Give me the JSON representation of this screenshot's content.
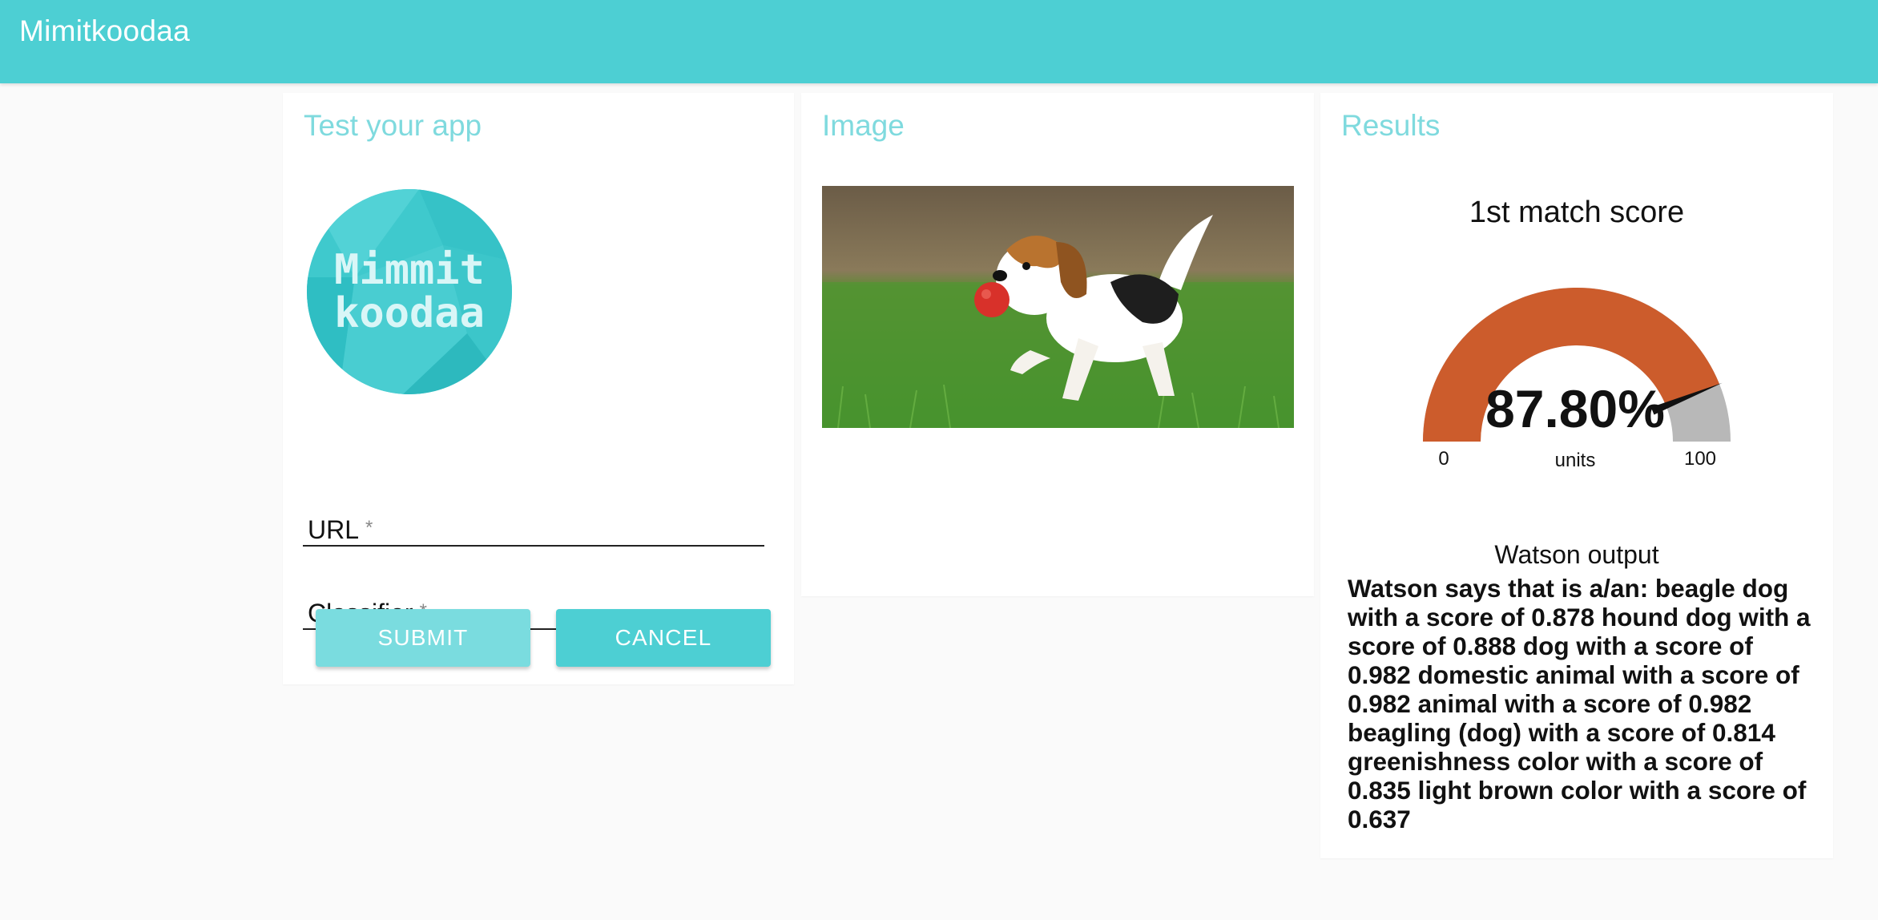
{
  "app": {
    "title": "Mimitkoodaa"
  },
  "test_panel": {
    "title": "Test your app",
    "logo_text": [
      "Mimmit",
      "koodaa"
    ],
    "url_label": "URL",
    "classifier_label": "Classifier",
    "required_mark": "*",
    "submit_label": "SUBMIT",
    "cancel_label": "CANCEL"
  },
  "image_panel": {
    "title": "Image"
  },
  "results_panel": {
    "title": "Results",
    "gauge": {
      "title": "1st match score",
      "value_text": "87.80%",
      "value": 87.8,
      "min_label": "0",
      "max_label": "100",
      "units_label": "units",
      "fill_color": "#cc5c2c",
      "track_color": "#b8b8b8"
    },
    "watson_title": "Watson output",
    "watson_text": "Watson says that is a/an: beagle dog with a score of 0.878 hound dog with a score of 0.888 dog with a score of 0.982 domestic animal with a score of 0.982 animal with a score of 0.982 beagling (dog) with a score of 0.814 greenishness color with a score of 0.835 light brown color with a score of 0.637"
  },
  "colors": {
    "accent": "#4dcfd3",
    "accent_light": "#7adcdf",
    "title_color": "#7fdade"
  }
}
